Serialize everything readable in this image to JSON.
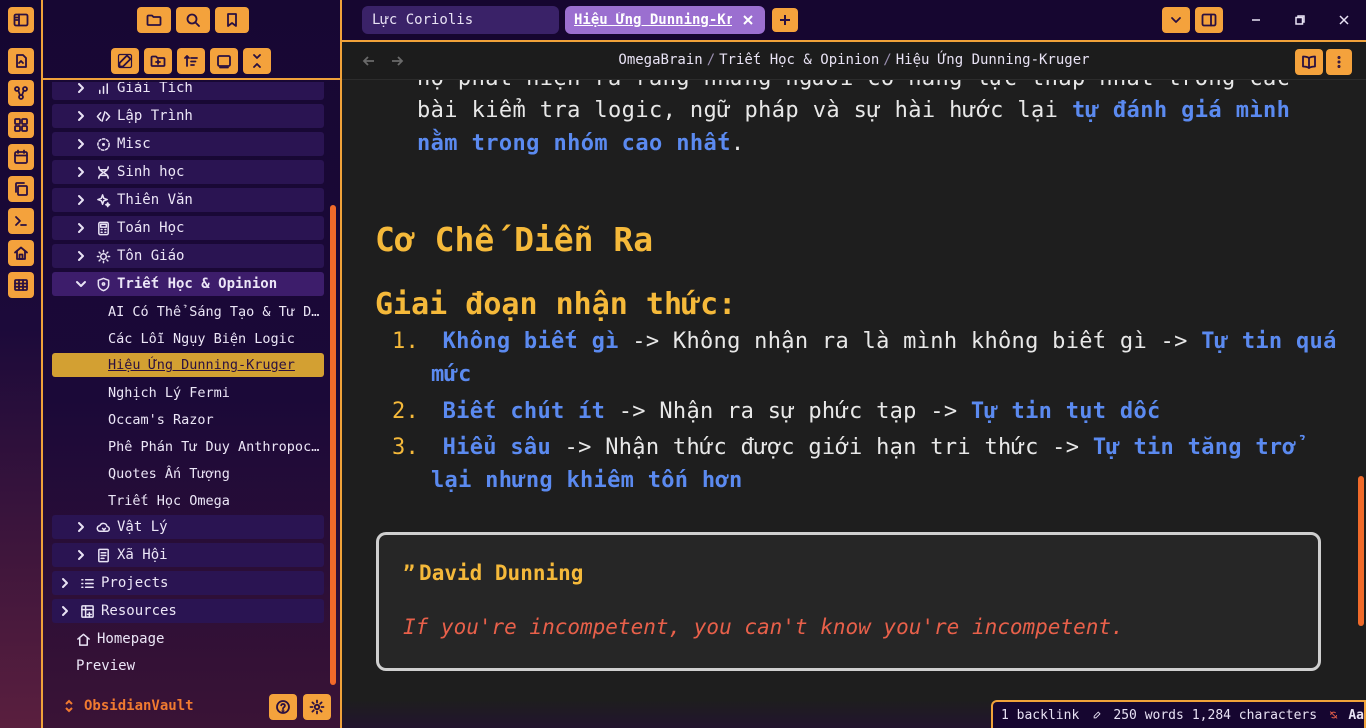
{
  "tabs": [
    {
      "label": "Lực Coriolis"
    },
    {
      "label": "Hiệu Ứng Dunning-Kruger"
    }
  ],
  "breadcrumb": {
    "root": "OmegaBrain",
    "folder": "Triết Học & Opinion",
    "file": "Hiệu Ứng Dunning-Kruger"
  },
  "tree": [
    {
      "label": "Giải Tích",
      "icon": "chart-icon"
    },
    {
      "label": "Lập Trình",
      "icon": "code-icon"
    },
    {
      "label": "Misc",
      "icon": "dashed-circle-icon"
    },
    {
      "label": "Sinh học",
      "icon": "dna-icon"
    },
    {
      "label": "Thiên Văn",
      "icon": "sparkles-icon"
    },
    {
      "label": "Toán Học",
      "icon": "calculator-icon"
    },
    {
      "label": "Tôn Giáo",
      "icon": "sun-icon"
    },
    {
      "label": "Triết Học & Opinion",
      "icon": "shield-icon"
    },
    {
      "label": "Vật Lý",
      "icon": "cloud-icon"
    },
    {
      "label": "Xã Hội",
      "icon": "document-icon"
    },
    {
      "label": "Projects",
      "icon": "list-icon"
    },
    {
      "label": "Resources",
      "icon": "grid-plus-icon"
    },
    {
      "label": "Homepage",
      "icon": "home-icon"
    },
    {
      "label": "Preview"
    }
  ],
  "files": [
    "AI Có Thể Sáng Tạo & Tư D…",
    "Các Lỗi Ngụy Biện Logic",
    "Hiệu Ứng Dunning-Kruger",
    "Nghịch Lý Fermi",
    "Occam's Razor",
    "Phê Phán Tư Duy Anthropoc…",
    "Quotes Ấn Tượng",
    "Triết Học Omega"
  ],
  "vault": {
    "name": "ObsidianVault"
  },
  "doc": {
    "line1": "họ phát hiện ra rằng những người có năng lực thấp nhất trong các",
    "line2_plain": "bài kiểm tra logic, ngữ pháp và sự hài hước lại ",
    "line2_hl": "tự đánh giá mình",
    "line3_hl": "nằm trong nhóm cao nhất",
    "line3_end": ".",
    "h2": "Cơ Chế Diễn Ra",
    "h3": "Giai đoạn nhận thức:",
    "items": [
      {
        "n": "1.",
        "a": "Không biết gì",
        "b": " -> Không nhận ra là mình không biết gì -> ",
        "c": "Tự tin quá",
        "d": "mức"
      },
      {
        "n": "2.",
        "a": "Biết chút ít",
        "b": " -> Nhận ra sự phức tạp -> ",
        "c": "Tự tin tụt dốc"
      },
      {
        "n": "3.",
        "a": "Hiểu sâu",
        "b": " -> Nhận thức được giới hạn tri thức -> ",
        "c": "Tự tin tăng trở",
        "d": "lại nhưng khiêm tốn hơn"
      }
    ],
    "callout": {
      "title": "David Dunning",
      "text": "If you're incompetent, you can't know you're incompetent."
    }
  },
  "status": {
    "backlinks": "1 backlink",
    "words": "250 words",
    "chars": "1,284 characters",
    "font": "Aa"
  }
}
